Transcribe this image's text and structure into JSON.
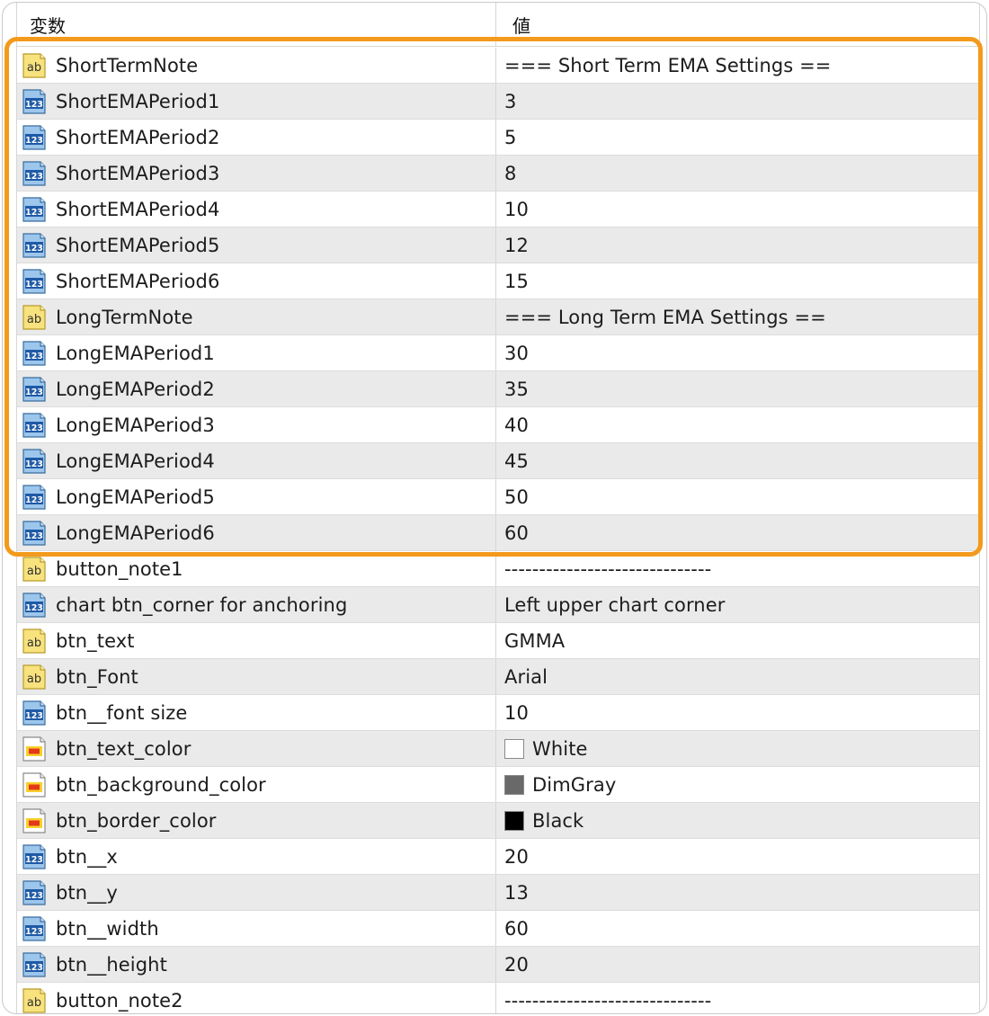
{
  "header": {
    "name_label": "変数",
    "value_label": "値"
  },
  "colors": {
    "highlight": "#f39a1c",
    "row_alt": "#eaeaea"
  },
  "rows": [
    {
      "name": "ShortTermNote",
      "value": "=== Short Term EMA Settings ==",
      "icon": "string-icon"
    },
    {
      "name": "ShortEMAPeriod1",
      "value": "3",
      "icon": "integer-icon"
    },
    {
      "name": "ShortEMAPeriod2",
      "value": "5",
      "icon": "integer-icon"
    },
    {
      "name": "ShortEMAPeriod3",
      "value": "8",
      "icon": "integer-icon"
    },
    {
      "name": "ShortEMAPeriod4",
      "value": "10",
      "icon": "integer-icon"
    },
    {
      "name": "ShortEMAPeriod5",
      "value": "12",
      "icon": "integer-icon"
    },
    {
      "name": "ShortEMAPeriod6",
      "value": "15",
      "icon": "integer-icon"
    },
    {
      "name": "LongTermNote",
      "value": "=== Long Term EMA Settings ==",
      "icon": "string-icon"
    },
    {
      "name": "LongEMAPeriod1",
      "value": "30",
      "icon": "integer-icon"
    },
    {
      "name": "LongEMAPeriod2",
      "value": "35",
      "icon": "integer-icon"
    },
    {
      "name": "LongEMAPeriod3",
      "value": "40",
      "icon": "integer-icon"
    },
    {
      "name": "LongEMAPeriod4",
      "value": "45",
      "icon": "integer-icon"
    },
    {
      "name": "LongEMAPeriod5",
      "value": "50",
      "icon": "integer-icon"
    },
    {
      "name": "LongEMAPeriod6",
      "value": "60",
      "icon": "integer-icon"
    },
    {
      "name": "button_note1",
      "value": "------------------------------",
      "icon": "string-icon"
    },
    {
      "name": "chart btn_corner for anchoring",
      "value": "Left upper chart corner",
      "icon": "integer-icon"
    },
    {
      "name": "btn_text",
      "value": "GMMA",
      "icon": "string-icon"
    },
    {
      "name": "btn_Font",
      "value": "Arial",
      "icon": "string-icon"
    },
    {
      "name": "btn__font size",
      "value": "10",
      "icon": "integer-icon"
    },
    {
      "name": "btn_text_color",
      "value": "White",
      "icon": "color-icon",
      "swatch": "#ffffff"
    },
    {
      "name": "btn_background_color",
      "value": "DimGray",
      "icon": "color-icon",
      "swatch": "#696969"
    },
    {
      "name": "btn_border_color",
      "value": "Black",
      "icon": "color-icon",
      "swatch": "#000000"
    },
    {
      "name": "btn__x",
      "value": "20",
      "icon": "integer-icon"
    },
    {
      "name": "btn__y",
      "value": "13",
      "icon": "integer-icon"
    },
    {
      "name": "btn__width",
      "value": "60",
      "icon": "integer-icon"
    },
    {
      "name": "btn__height",
      "value": "20",
      "icon": "integer-icon"
    },
    {
      "name": "button_note2",
      "value": "------------------------------",
      "icon": "string-icon"
    }
  ]
}
